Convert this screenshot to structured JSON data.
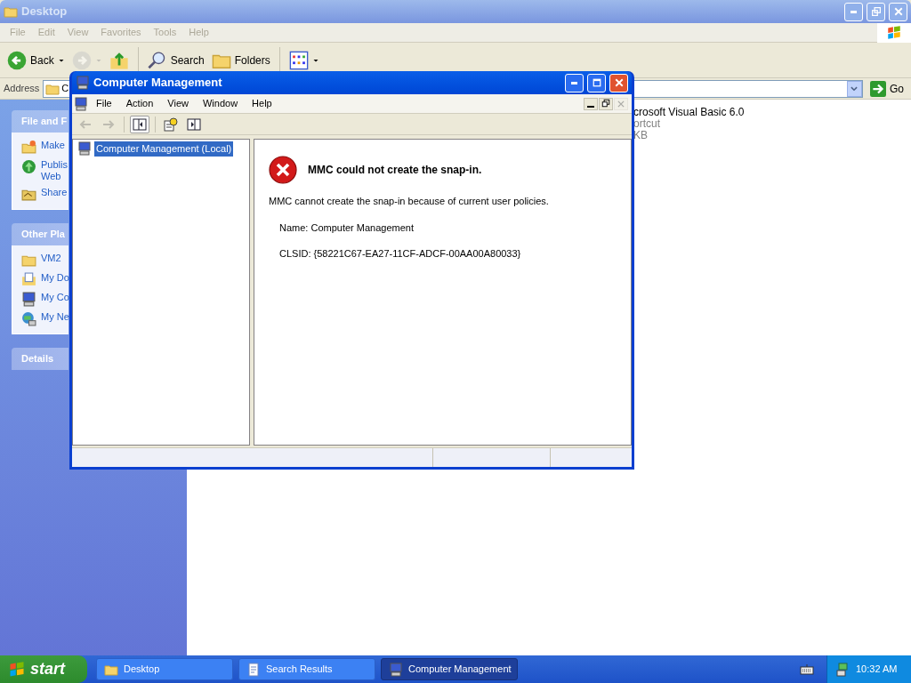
{
  "explorer": {
    "title": "Desktop",
    "active": false,
    "menu": [
      "File",
      "Edit",
      "View",
      "Favorites",
      "Tools",
      "Help"
    ],
    "toolbar": [
      {
        "kind": "back",
        "label": "Back",
        "disabled": false
      },
      {
        "kind": "forward",
        "disabled": true
      },
      {
        "kind": "up",
        "disabled": false
      },
      {
        "kind": "search",
        "label": "Search",
        "disabled": false
      },
      {
        "kind": "folders",
        "label": "Folders",
        "disabled": false
      },
      {
        "kind": "views",
        "disabled": false
      }
    ],
    "address": {
      "label": "Address",
      "value": "C",
      "go": "Go"
    },
    "panels": [
      {
        "title": "File and F",
        "items": [
          {
            "kind": "folder-star",
            "label": "Make"
          },
          {
            "kind": "globe",
            "label": "Publis\nWeb"
          },
          {
            "kind": "share",
            "label": "Share"
          }
        ]
      },
      {
        "title": "Other Pla",
        "items": [
          {
            "kind": "folder",
            "label": "VM2"
          },
          {
            "kind": "docs",
            "label": "My Do"
          },
          {
            "kind": "computer",
            "label": "My Co"
          },
          {
            "kind": "network",
            "label": "My Ne"
          }
        ]
      },
      {
        "title": "Details"
      }
    ],
    "file": {
      "name": "crosoft Visual Basic 6.0",
      "type": "ortcut",
      "size": "KB"
    }
  },
  "mmc": {
    "title": "Computer Management",
    "active": true,
    "menu": [
      "File",
      "Action",
      "View",
      "Window",
      "Help"
    ],
    "toolbar": [
      {
        "kind": "back",
        "disabled": true
      },
      {
        "kind": "forward",
        "disabled": true
      },
      {
        "kind": "tree",
        "disabled": false,
        "selected": true
      },
      {
        "kind": "help",
        "disabled": false,
        "selected": false
      },
      {
        "kind": "pane",
        "disabled": false,
        "selected": false
      }
    ],
    "mdi_close_disabled": true,
    "tree": [
      {
        "label": "Computer Management (Local)",
        "selected": true
      }
    ],
    "error": {
      "title": "MMC could not create the snap-in.",
      "message": "MMC cannot create the snap-in because of current user policies.",
      "name": "Name: Computer Management",
      "clsid": "CLSID: {58221C67-EA27-11CF-ADCF-00AA00A80033}"
    }
  },
  "taskbar": {
    "start": "start",
    "tasks": [
      {
        "kind": "folder",
        "label": "Desktop",
        "selected": false
      },
      {
        "kind": "search",
        "label": "Search Results",
        "selected": false
      },
      {
        "kind": "computer",
        "label": "Computer Management",
        "selected": true
      }
    ],
    "clock": "10:32 AM"
  }
}
